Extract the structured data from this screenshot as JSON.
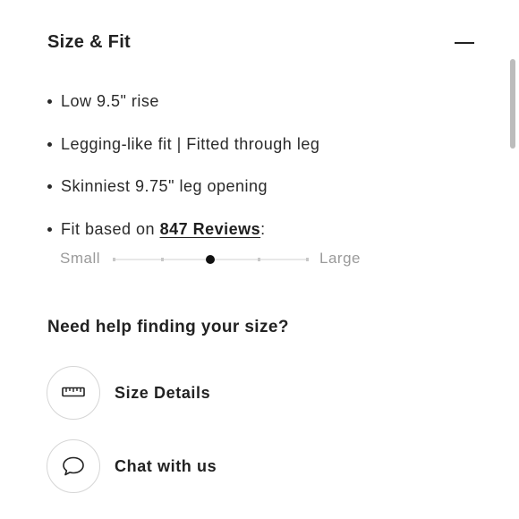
{
  "section": {
    "title": "Size & Fit",
    "collapse_icon": "minus-icon"
  },
  "fit_details": [
    {
      "text": "Low 9.5\" rise"
    },
    {
      "text": "Legging-like fit | Fitted through leg"
    },
    {
      "text": "Skinniest 9.75\" leg opening"
    }
  ],
  "fit_reviews": {
    "prefix": "Fit based on ",
    "link_text": "847 Reviews",
    "suffix": ":"
  },
  "fit_scale": {
    "min_label": "Small",
    "max_label": "Large",
    "steps": 5,
    "selected_step": 3
  },
  "help": {
    "title": "Need help finding your size?",
    "actions": [
      {
        "label": "Size Details",
        "icon": "ruler-icon"
      },
      {
        "label": "Chat with us",
        "icon": "chat-bubble-icon"
      }
    ]
  }
}
